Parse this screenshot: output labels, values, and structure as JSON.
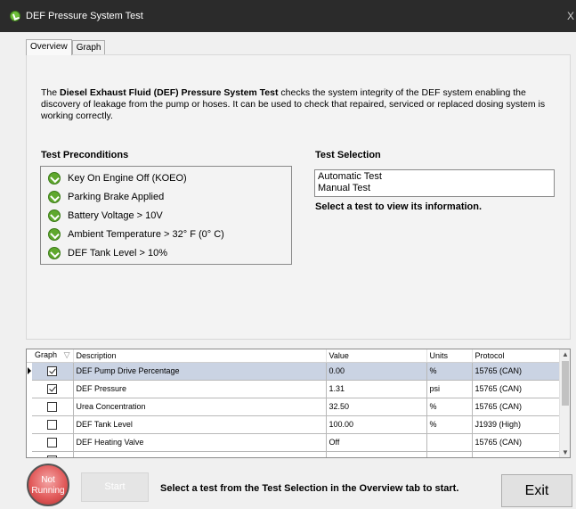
{
  "window": {
    "title": "DEF Pressure System Test",
    "close_glyph": "X"
  },
  "tabs": [
    {
      "label": "Overview",
      "active": true
    },
    {
      "label": "Graph",
      "active": false
    }
  ],
  "overview": {
    "intro_prefix": "The ",
    "intro_bold": "Diesel Exhaust Fluid (DEF) Pressure System Test",
    "intro_suffix": " checks the system integrity of the DEF system enabling the discovery of leakage from the pump or hoses.  It can be used to check that repaired, serviced or replaced dosing system is working correctly.",
    "preconditions_title": "Test Preconditions",
    "preconditions": [
      "Key On Engine Off (KOEO)",
      "Parking Brake Applied",
      "Battery Voltage > 10V",
      "Ambient Temperature > 32° F (0° C)",
      "DEF Tank Level > 10%"
    ],
    "test_selection_title": "Test Selection",
    "test_options": [
      "Automatic Test",
      "Manual Test"
    ],
    "selection_hint": "Select a test to view its information."
  },
  "grid": {
    "columns": {
      "graph": "Graph",
      "description": "Description",
      "value": "Value",
      "units": "Units",
      "protocol": "Protocol"
    },
    "rows": [
      {
        "checked": true,
        "description": "DEF Pump Drive Percentage",
        "value": "0.00",
        "units": "%",
        "protocol": "15765 (CAN)",
        "selected": true
      },
      {
        "checked": true,
        "description": "DEF Pressure",
        "value": "1.31",
        "units": "psi",
        "protocol": "15765 (CAN)",
        "selected": false
      },
      {
        "checked": false,
        "description": "Urea Concentration",
        "value": "32.50",
        "units": "%",
        "protocol": "15765 (CAN)",
        "selected": false
      },
      {
        "checked": false,
        "description": "DEF Tank Level",
        "value": "100.00",
        "units": "%",
        "protocol": "J1939 (High)",
        "selected": false
      },
      {
        "checked": false,
        "description": "DEF Heating Valve",
        "value": "Off",
        "units": "",
        "protocol": "15765 (CAN)",
        "selected": false
      }
    ]
  },
  "footer": {
    "status_line1": "Not",
    "status_line2": "Running",
    "start_label": "Start",
    "hint": "Select a test from the Test Selection in the Overview tab to start.",
    "exit_label": "Exit"
  },
  "colors": {
    "titlebar": "#2b2b2b",
    "status_red": "#e25b5b",
    "check_green": "#5fa82d",
    "row_selected": "#cad3e3"
  }
}
